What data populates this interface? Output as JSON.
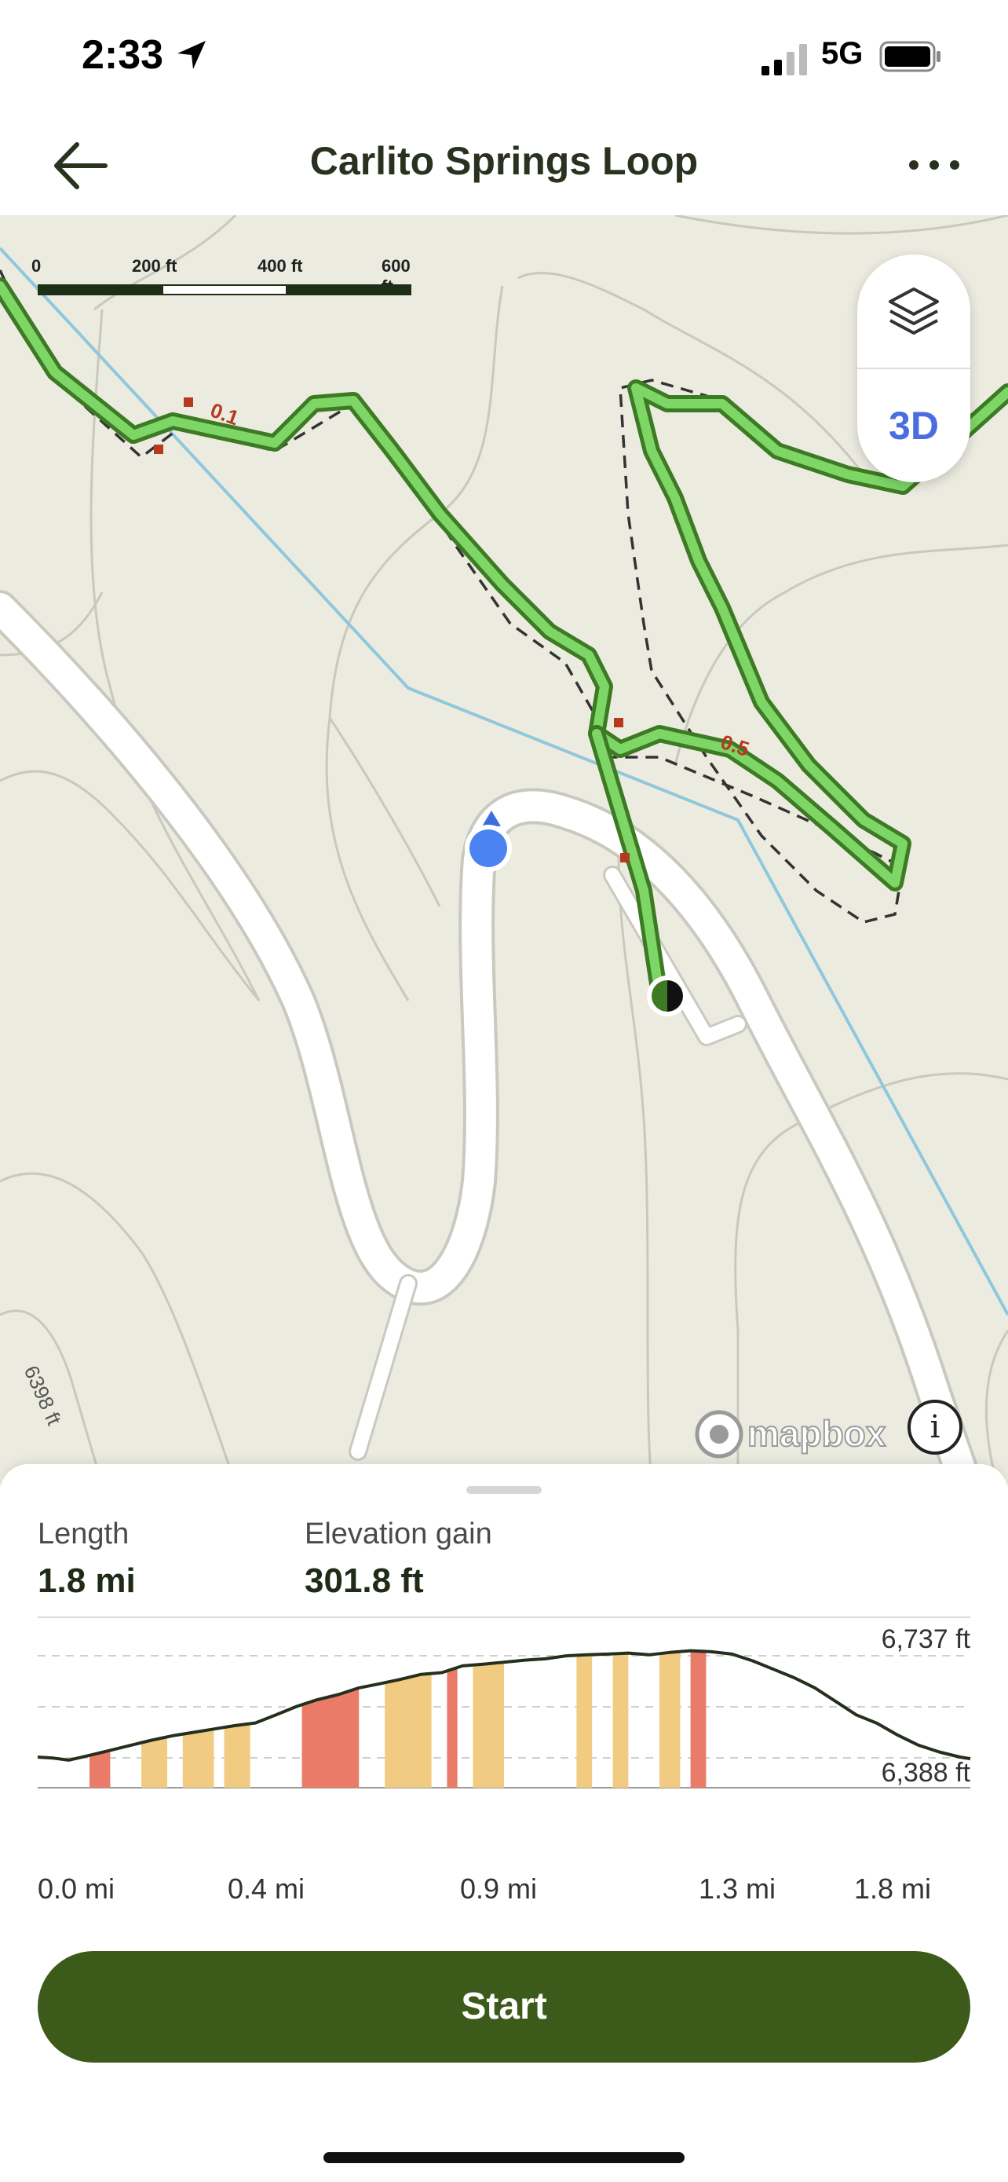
{
  "status_bar": {
    "time": "2:33",
    "network": "5G"
  },
  "header": {
    "title": "Carlito Springs Loop",
    "back_icon": "arrow-left-icon",
    "more_icon": "more-dots-icon"
  },
  "map": {
    "scale_labels": [
      "0",
      "200 ft",
      "400 ft",
      "600 ft"
    ],
    "three_d_label": "3D",
    "layers_icon": "layers-icon",
    "attribution": "mapbox",
    "info_label": "i",
    "contour_label": "6398 ft",
    "trail_markers": [
      "0.1",
      "0.5"
    ]
  },
  "stats": {
    "length_label": "Length",
    "length_value": "1.8 mi",
    "elevation_label": "Elevation gain",
    "elevation_value": "301.8 ft"
  },
  "chart_data": {
    "type": "area",
    "x_tick_labels": [
      "0.0 mi",
      "0.4 mi",
      "0.9 mi",
      "1.3 mi",
      "1.8 mi"
    ],
    "y_labels": [
      "6,737 ft",
      "6,388 ft"
    ],
    "ylim": [
      6388,
      6737
    ],
    "xlim": [
      0,
      1.8
    ],
    "x": [
      0.0,
      0.03,
      0.06,
      0.1,
      0.14,
      0.18,
      0.22,
      0.26,
      0.3,
      0.34,
      0.38,
      0.42,
      0.46,
      0.5,
      0.54,
      0.58,
      0.62,
      0.66,
      0.7,
      0.74,
      0.78,
      0.82,
      0.86,
      0.9,
      0.94,
      0.98,
      1.02,
      1.06,
      1.1,
      1.14,
      1.18,
      1.22,
      1.26,
      1.3,
      1.34,
      1.38,
      1.42,
      1.46,
      1.5,
      1.54,
      1.58,
      1.62,
      1.66,
      1.7,
      1.74,
      1.78,
      1.8
    ],
    "y": [
      6395,
      6392,
      6386,
      6400,
      6415,
      6430,
      6445,
      6458,
      6468,
      6478,
      6488,
      6496,
      6520,
      6545,
      6565,
      6580,
      6600,
      6612,
      6625,
      6640,
      6645,
      6665,
      6670,
      6676,
      6682,
      6686,
      6695,
      6698,
      6700,
      6703,
      6698,
      6705,
      6710,
      6707,
      6700,
      6680,
      6655,
      6630,
      6600,
      6560,
      6520,
      6495,
      6460,
      6430,
      6410,
      6395,
      6390
    ],
    "grade_bands": [
      {
        "start": 0.1,
        "end": 0.14,
        "level": "steep"
      },
      {
        "start": 0.2,
        "end": 0.25,
        "level": "moderate"
      },
      {
        "start": 0.28,
        "end": 0.34,
        "level": "moderate"
      },
      {
        "start": 0.36,
        "end": 0.41,
        "level": "moderate"
      },
      {
        "start": 0.51,
        "end": 0.62,
        "level": "steep"
      },
      {
        "start": 0.67,
        "end": 0.76,
        "level": "moderate"
      },
      {
        "start": 0.79,
        "end": 0.81,
        "level": "steep"
      },
      {
        "start": 0.84,
        "end": 0.9,
        "level": "moderate"
      },
      {
        "start": 1.04,
        "end": 1.07,
        "level": "moderate"
      },
      {
        "start": 1.11,
        "end": 1.14,
        "level": "moderate"
      },
      {
        "start": 1.2,
        "end": 1.24,
        "level": "moderate"
      },
      {
        "start": 1.26,
        "end": 1.29,
        "level": "steep"
      }
    ],
    "grade_colors": {
      "moderate": "#f1cb82",
      "steep": "#e97b68"
    },
    "line_color": "#24301d",
    "grid": true
  },
  "start_button": {
    "label": "Start"
  },
  "colors": {
    "trail_green": "#6fcf5b",
    "trail_outline": "#3d7a24",
    "start_button": "#3c5a1a",
    "user_location": "#4b84f2",
    "accent_blue": "#4a6ee0"
  }
}
